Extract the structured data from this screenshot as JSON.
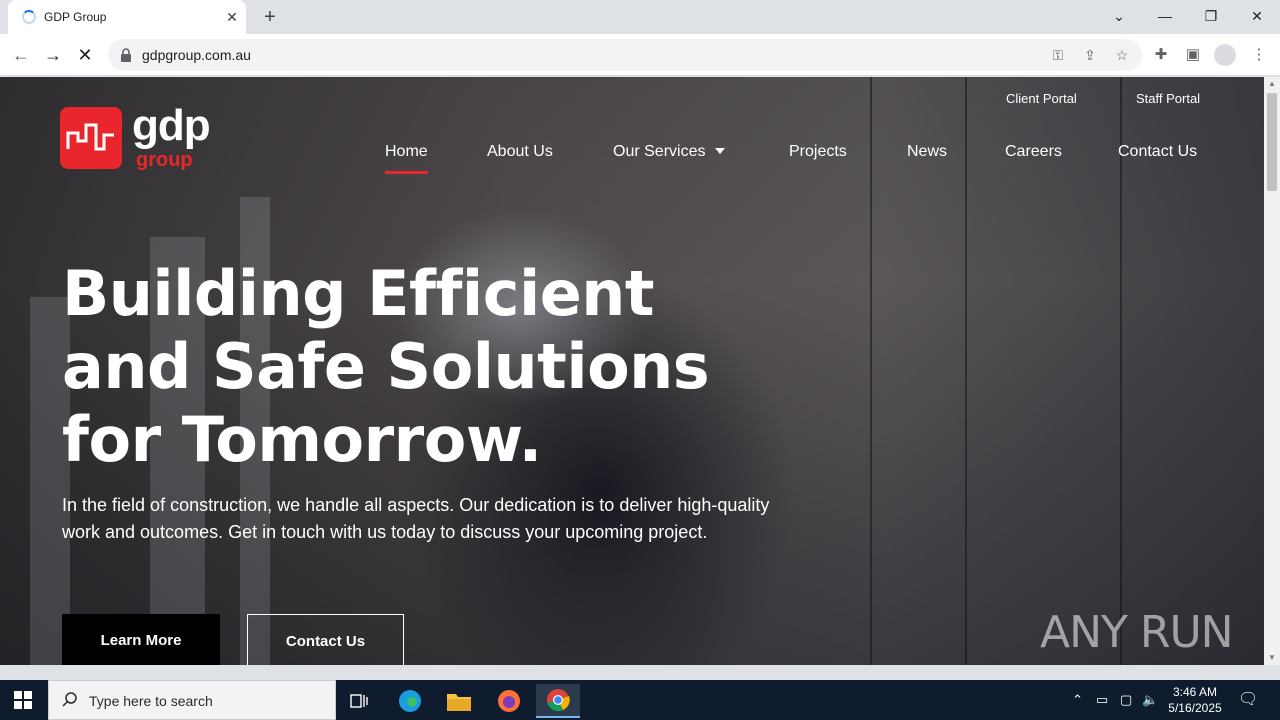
{
  "browser": {
    "tab_title": "GDP Group",
    "new_tab": "+",
    "url": "gdpgroup.com.au"
  },
  "site": {
    "logo_text": "gdp",
    "logo_subtext": "group",
    "top_links": [
      "Client Portal",
      "Staff Portal"
    ],
    "menu": [
      {
        "label": "Home",
        "active": true
      },
      {
        "label": "About Us"
      },
      {
        "label": "Our Services",
        "dropdown": true
      },
      {
        "label": "Projects"
      },
      {
        "label": "News"
      },
      {
        "label": "Careers"
      },
      {
        "label": "Contact Us"
      }
    ],
    "hero": {
      "title": "Building Efficient\nand Safe Solutions\nfor Tomorrow.",
      "text": "In the field of construction, we handle all aspects. Our dedication is to deliver high-quality work and outcomes. Get in touch with us today to discuss your upcoming project.",
      "primary_button": "Learn More",
      "secondary_button": "Contact Us"
    },
    "watermark": "ANY RUN"
  },
  "taskbar": {
    "search_placeholder": "Type here to search",
    "time": "3:46 AM",
    "date": "5/16/2025"
  },
  "colors": {
    "brand_red": "#e8262b",
    "taskbar": "#0f1c2e"
  }
}
